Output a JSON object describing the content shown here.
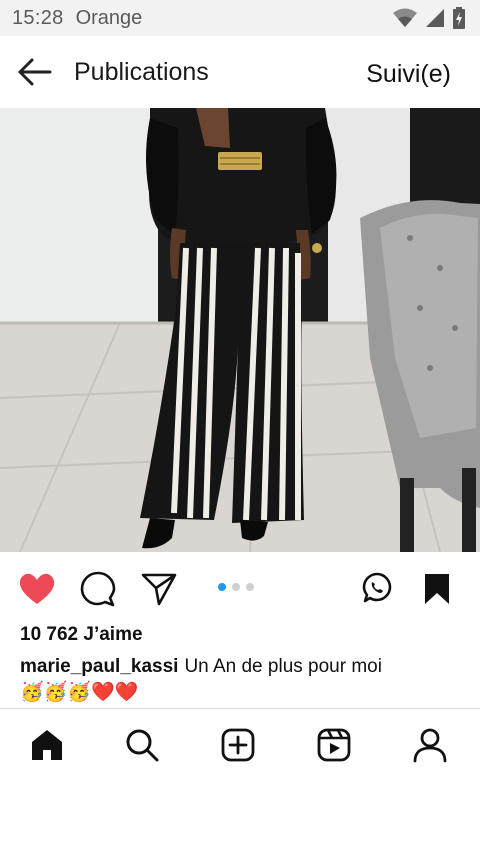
{
  "status": {
    "time": "15:28",
    "carrier": "Orange"
  },
  "header": {
    "title": "Publications",
    "follow_label": "Suivi(e)"
  },
  "post": {
    "likes": "10 762 J’aime",
    "username": "marie_paul_kassi",
    "caption": "Un An de plus pour moi",
    "caption_continued": "🥳🥳🥳❤️❤️",
    "carousel_count": 3,
    "carousel_active": 1,
    "liked": true,
    "saved": true
  },
  "icons": {
    "back": "arrow-left-icon",
    "like": "heart-icon",
    "comment": "comment-icon",
    "share": "send-icon",
    "whatsapp": "whatsapp-icon",
    "save": "bookmark-icon",
    "home": "home-icon",
    "search": "search-icon",
    "create": "add-post-icon",
    "reels": "reels-icon",
    "profile": "profile-icon"
  },
  "colors": {
    "like": "#ed4956",
    "carousel_active": "#2196f3",
    "text": "#111111"
  }
}
